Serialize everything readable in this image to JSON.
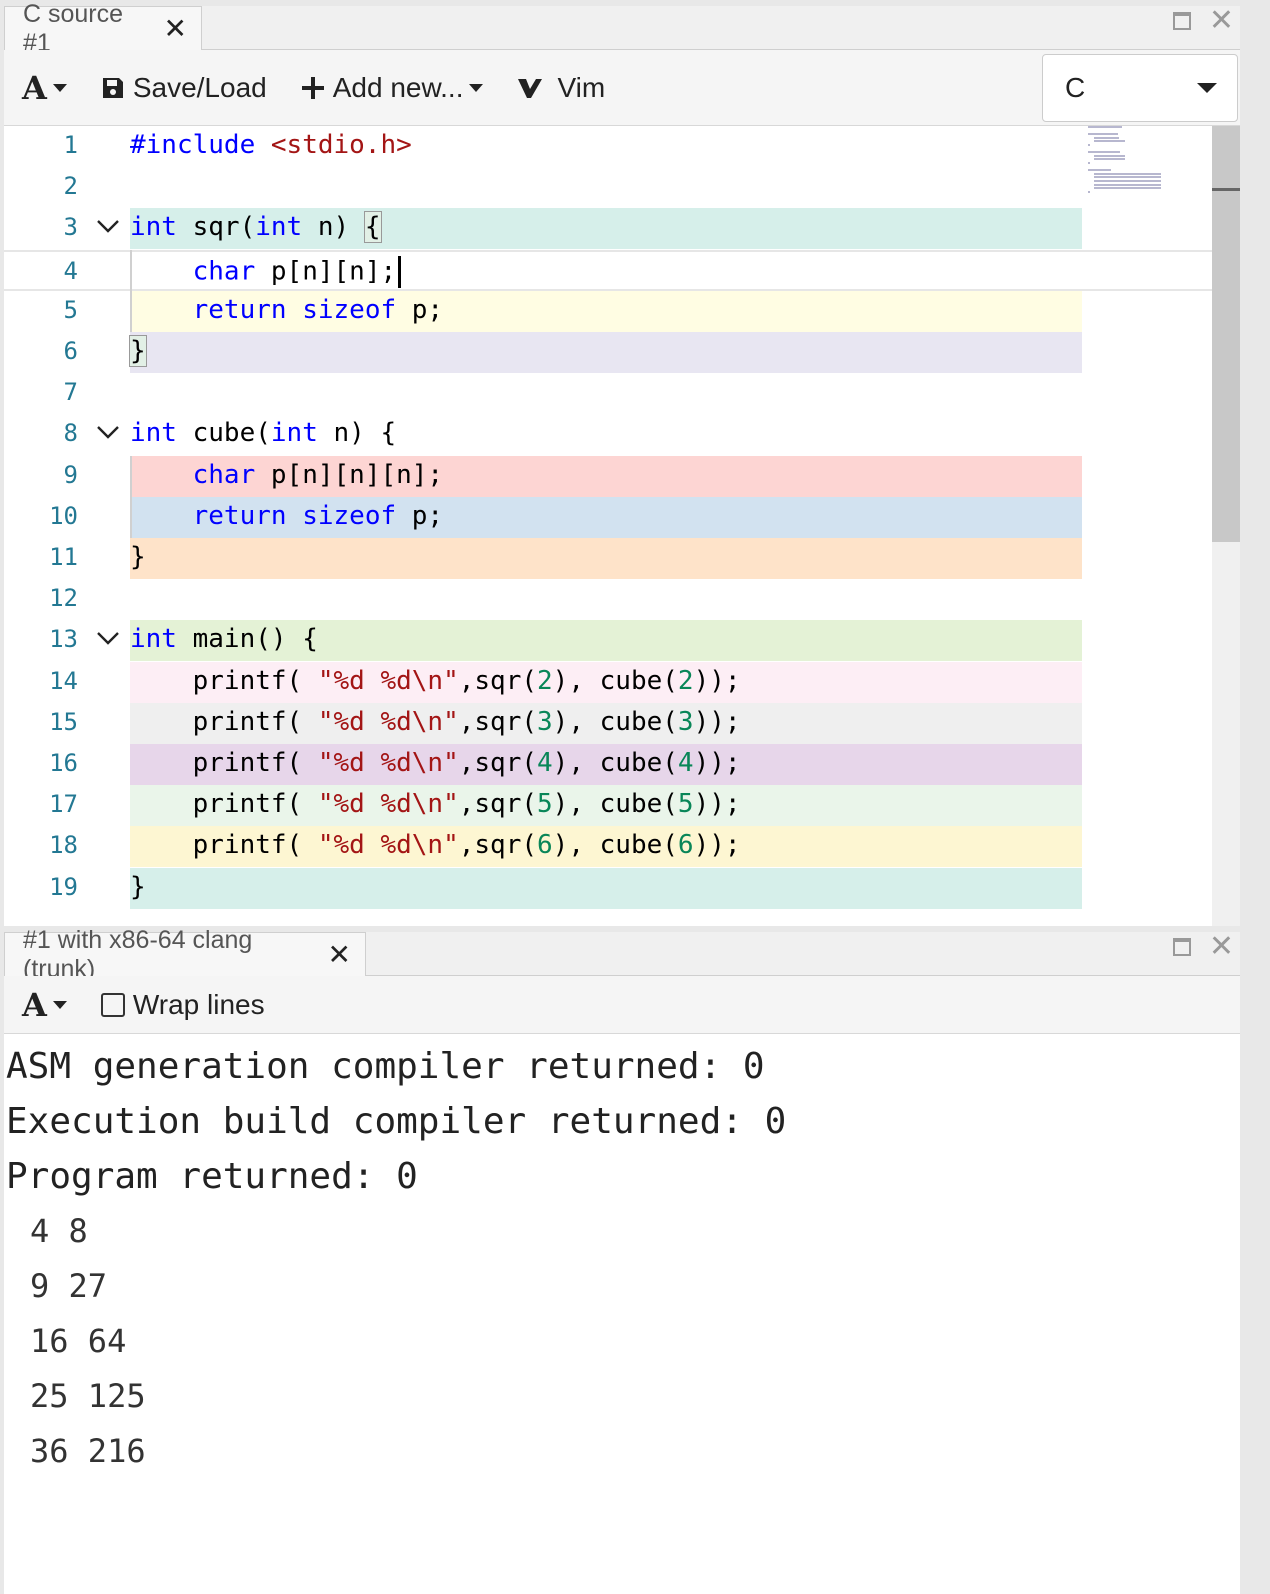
{
  "source_panel": {
    "tab_title": "C source #1",
    "tab_close": "✕",
    "toolbar": {
      "font_button": "A",
      "save_load_label": "Save/Load",
      "add_new_label": "Add new...",
      "vim_label": "Vim"
    },
    "language_select": {
      "selected": "C"
    },
    "code_lines": [
      {
        "n": "1",
        "text": "#include <stdio.h>",
        "fold": false,
        "bg": ""
      },
      {
        "n": "2",
        "text": "",
        "fold": false,
        "bg": ""
      },
      {
        "n": "3",
        "text": "int sqr(int n) {",
        "fold": true,
        "bg": "#d6efea"
      },
      {
        "n": "4",
        "text": "    char p[n][n];",
        "fold": false,
        "bg": ""
      },
      {
        "n": "5",
        "text": "    return sizeof p;",
        "fold": false,
        "bg": "#fffde3"
      },
      {
        "n": "6",
        "text": "}",
        "fold": false,
        "bg": "#e8e6f2"
      },
      {
        "n": "7",
        "text": "",
        "fold": false,
        "bg": ""
      },
      {
        "n": "8",
        "text": "int cube(int n) {",
        "fold": true,
        "bg": ""
      },
      {
        "n": "9",
        "text": "    char p[n][n][n];",
        "fold": false,
        "bg": "#fdd5d3"
      },
      {
        "n": "10",
        "text": "    return sizeof p;",
        "fold": false,
        "bg": "#d2e2f0"
      },
      {
        "n": "11",
        "text": "}",
        "fold": false,
        "bg": "#fee3c9"
      },
      {
        "n": "12",
        "text": "",
        "fold": false,
        "bg": ""
      },
      {
        "n": "13",
        "text": "int main() {",
        "fold": true,
        "bg": "#e4f2d6"
      },
      {
        "n": "14",
        "text": "    printf( \"%d %d\\n\",sqr(2), cube(2));",
        "fold": false,
        "bg": "#fdeef5"
      },
      {
        "n": "15",
        "text": "    printf( \"%d %d\\n\",sqr(3), cube(3));",
        "fold": false,
        "bg": "#efefef"
      },
      {
        "n": "16",
        "text": "    printf( \"%d %d\\n\",sqr(4), cube(4));",
        "fold": false,
        "bg": "#e7d6ea"
      },
      {
        "n": "17",
        "text": "    printf( \"%d %d\\n\",sqr(5), cube(5));",
        "fold": false,
        "bg": "#eaf5ea"
      },
      {
        "n": "18",
        "text": "    printf( \"%d %d\\n\",sqr(6), cube(6));",
        "fold": false,
        "bg": "#fdf6d2"
      },
      {
        "n": "19",
        "text": "}",
        "fold": false,
        "bg": "#d6efea"
      }
    ]
  },
  "output_panel": {
    "tab_title": "#1 with x86-64 clang (trunk)",
    "tab_close": "✕",
    "toolbar": {
      "font_button": "A",
      "wrap_label": "Wrap lines",
      "wrap_checked": false
    },
    "status_lines": [
      "ASM generation compiler returned: 0",
      "Execution build compiler returned: 0",
      "Program returned: 0"
    ],
    "stdout_lines": [
      "4 8",
      "9 27",
      "16 64",
      "25 125",
      "36 216"
    ]
  },
  "icons": {
    "save": "floppy-disk-icon",
    "add": "plus-icon",
    "vim": "vim-logo-icon",
    "fold": "chevron-down-icon",
    "maximize": "maximize-icon",
    "close": "close-icon"
  }
}
